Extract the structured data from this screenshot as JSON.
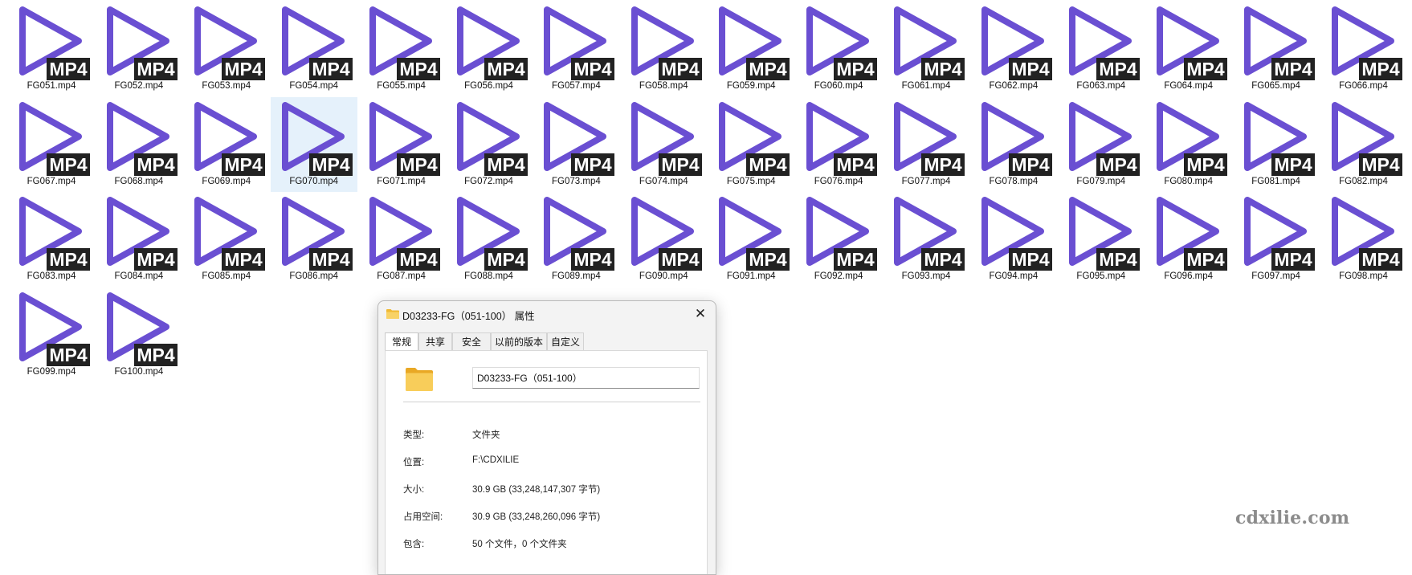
{
  "files": [
    "FG051.mp4",
    "FG052.mp4",
    "FG053.mp4",
    "FG054.mp4",
    "FG055.mp4",
    "FG056.mp4",
    "FG057.mp4",
    "FG058.mp4",
    "FG059.mp4",
    "FG060.mp4",
    "FG061.mp4",
    "FG062.mp4",
    "FG063.mp4",
    "FG064.mp4",
    "FG065.mp4",
    "FG066.mp4",
    "FG067.mp4",
    "FG068.mp4",
    "FG069.mp4",
    "FG070.mp4",
    "FG071.mp4",
    "FG072.mp4",
    "FG073.mp4",
    "FG074.mp4",
    "FG075.mp4",
    "FG076.mp4",
    "FG077.mp4",
    "FG078.mp4",
    "FG079.mp4",
    "FG080.mp4",
    "FG081.mp4",
    "FG082.mp4",
    "FG083.mp4",
    "FG084.mp4",
    "FG085.mp4",
    "FG086.mp4",
    "FG087.mp4",
    "FG088.mp4",
    "FG089.mp4",
    "FG090.mp4",
    "FG091.mp4",
    "FG092.mp4",
    "FG093.mp4",
    "FG094.mp4",
    "FG095.mp4",
    "FG096.mp4",
    "FG097.mp4",
    "FG098.mp4",
    "FG099.mp4",
    "FG100.mp4"
  ],
  "selected_file": "FG070.mp4",
  "file_badge": "MP4",
  "icon_colors": {
    "play_outline": "#6a4fd2",
    "badge_bg": "#222222",
    "badge_text": "#ffffff",
    "selection": "#e5f1fb"
  },
  "dialog": {
    "title": "D03233-FG（051-100） 属性",
    "close_glyph": "✕",
    "tabs": [
      "常规",
      "共享",
      "安全",
      "以前的版本",
      "自定义"
    ],
    "active_tab": "常规",
    "name_value": "D03233-FG（051-100）",
    "properties": [
      {
        "label": "类型:",
        "value": "文件夹"
      },
      {
        "label": "位置:",
        "value": "F:\\CDXILIE"
      },
      {
        "label": "大小:",
        "value": "30.9 GB (33,248,147,307 字节)"
      },
      {
        "label": "占用空间:",
        "value": "30.9 GB (33,248,260,096 字节)"
      },
      {
        "label": "包含:",
        "value": "50 个文件，0 个文件夹"
      }
    ],
    "folder_color": "#f5c542"
  },
  "watermark": "cdxilie.com"
}
